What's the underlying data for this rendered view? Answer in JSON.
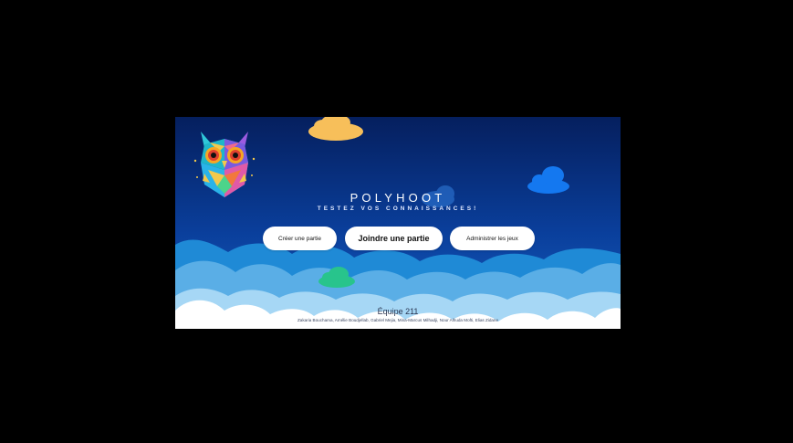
{
  "app": {
    "title": "POLYHOOT",
    "subtitle": "TESTEZ VOS CONNAISSANCES!"
  },
  "buttons": {
    "create": "Créer une partie",
    "join": "Joindre une partie",
    "admin": "Administrer les jeux"
  },
  "footer": {
    "team": "Équipe 211",
    "members": "Zakaria Bouchama, Amélie Boudjellab, Gabriel Mejia, Mina-Marcus Milhadji, Nour Alhuda Mofti, Elias Zidane"
  },
  "colors": {
    "background_top": "#051f5e",
    "background_bottom": "#1660c0",
    "cloud_yellow": "#f7bf5a",
    "cloud_blue": "#1478f0",
    "cloud_green": "#28c48c",
    "button_bg": "#ffffff"
  },
  "icons": {
    "logo": "owl-logo"
  }
}
